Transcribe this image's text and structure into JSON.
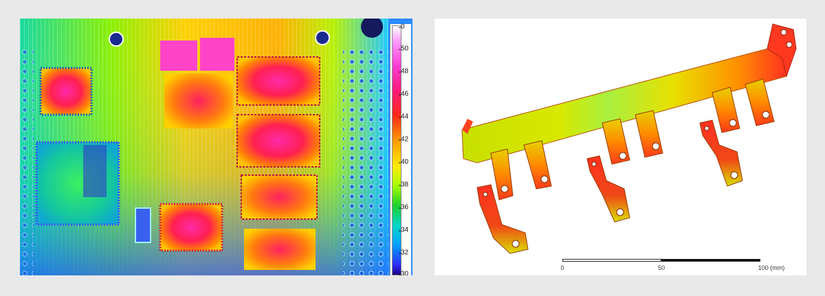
{
  "thermal_image": {
    "colorbar_ticks": [
      "50",
      "48",
      "46",
      "44",
      "42",
      "40",
      "38",
      "36",
      "34",
      "32"
    ],
    "colorbar_top_partial": "0",
    "colorbar_bottom_partial": "30"
  },
  "fea_image": {
    "scale_labels": [
      "0",
      "50",
      "100 (mm)"
    ]
  }
}
